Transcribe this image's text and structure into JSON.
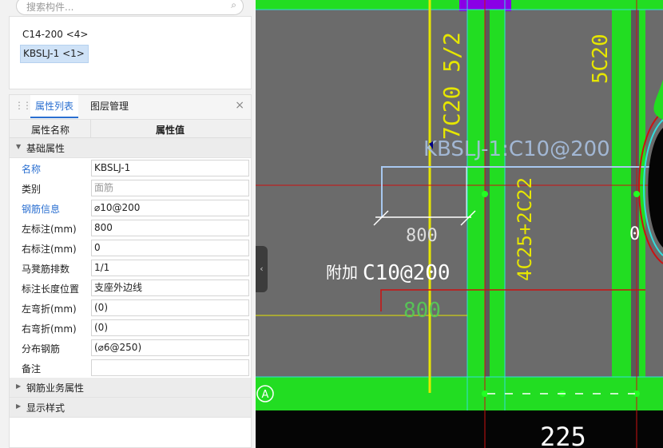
{
  "search": {
    "placeholder": "搜索构件..."
  },
  "components": [
    {
      "label": "C14-200 <4>"
    },
    {
      "label": "KBSLJ-1 <1>"
    }
  ],
  "panel": {
    "tabs": [
      "属性列表",
      "图层管理"
    ],
    "close": "×",
    "header": {
      "name_col": "属性名称",
      "value_col": "属性值"
    },
    "group_basic": "基础属性",
    "rows": [
      {
        "name": "名称",
        "value": "KBSLJ-1"
      },
      {
        "name": "类别",
        "value": "面筋"
      },
      {
        "name": "钢筋信息",
        "value": "⌀10@200"
      },
      {
        "name": "左标注(mm)",
        "value": "800"
      },
      {
        "name": "右标注(mm)",
        "value": "0"
      },
      {
        "name": "马凳筋排数",
        "value": "1/1"
      },
      {
        "name": "标注长度位置",
        "value": "支座外边线"
      },
      {
        "name": "左弯折(mm)",
        "value": "(0)"
      },
      {
        "name": "右弯折(mm)",
        "value": "(0)"
      },
      {
        "name": "分布钢筋",
        "value": "(⌀6@250)"
      },
      {
        "name": "备注",
        "value": ""
      }
    ],
    "group_rebar": "钢筋业务属性",
    "group_display": "显示样式"
  },
  "canvas": {
    "labels": {
      "rebar_label": "KBSLJ-1:C10@200",
      "c20": "7C20 5/2",
      "fivec20": "5C20",
      "vertical_text": "4C25+2C22",
      "dim_800": "800",
      "dim_0": "0",
      "fujia": "附加",
      "c10": "C10@200",
      "dim_800_yellow": "800",
      "axis_a": "A",
      "dim_225": "225"
    },
    "colors": {
      "beam": "#22dd22",
      "background": "#6b6b6b",
      "yellow": "#e6e600",
      "red": "#cc1111"
    }
  }
}
